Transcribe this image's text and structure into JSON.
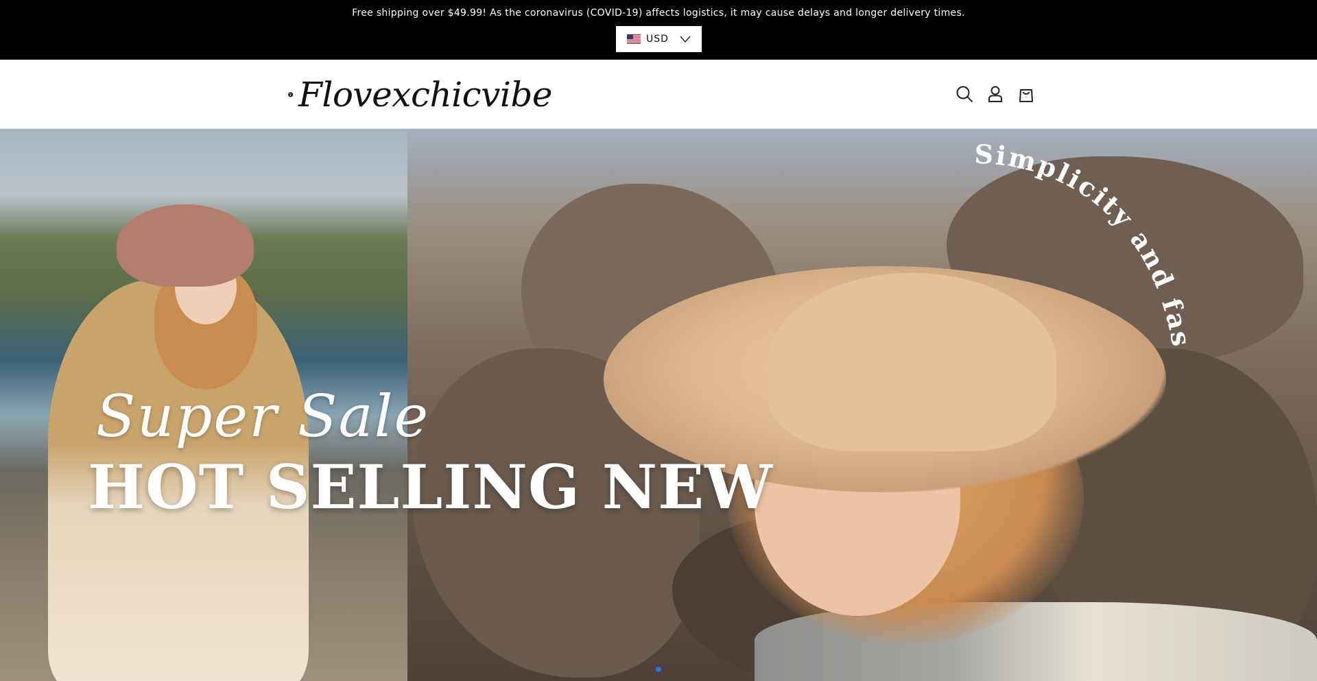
{
  "announcement": {
    "text": "Free shipping over $49.99! As the coronavirus (COVID-19) affects logistics, it may cause delays and longer delivery times."
  },
  "currency": {
    "code": "USD",
    "flag_icon": "us-flag-icon"
  },
  "header": {
    "logo_text": "Flovexchicvibe",
    "icons": [
      "search-icon",
      "account-icon",
      "cart-icon"
    ]
  },
  "hero": {
    "script_text": "Super Sale",
    "headline": "HOT SELLING NEW",
    "arc_text": "Simplicity and fashion",
    "slides_total": 1,
    "active_slide": 1
  },
  "colors": {
    "announcement_bg": "#000000",
    "header_bg": "#ffffff",
    "slide_dot_active": "#1a73e8"
  }
}
